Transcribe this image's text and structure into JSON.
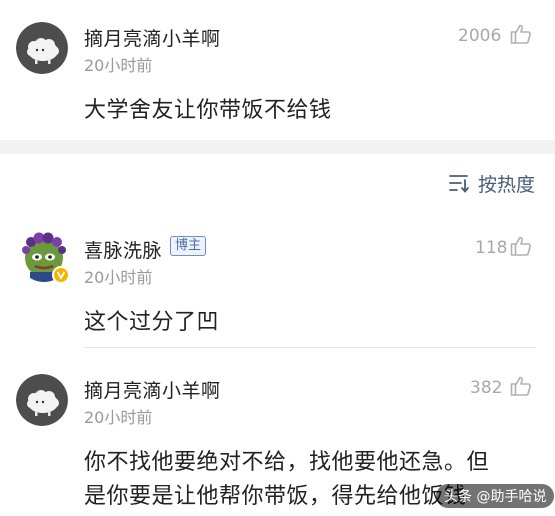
{
  "top_comment": {
    "author": "摘月亮滴小羊啊",
    "time": "20小时前",
    "likes": "2006",
    "text": "大学舍友让你带饭不给钱"
  },
  "sort_control": {
    "icon": "sort-icon",
    "label": "按热度"
  },
  "replies": [
    {
      "author": "喜脉洗脉",
      "badge": "博主",
      "time": "20小时前",
      "likes": "118",
      "text": "这个过分了凹"
    },
    {
      "author": "摘月亮滴小羊啊",
      "time": "20小时前",
      "likes": "382",
      "text_line1": "你不找他要绝对不给，找他要他还急。但",
      "text_line2": "是你要是让他帮你带饭，得先给他饭钱"
    }
  ],
  "watermark": "头条 @助手哈说",
  "colors": {
    "separator": "#f2f2f2",
    "badge": "#4a6fa5",
    "sort": "#4a5b7a"
  }
}
